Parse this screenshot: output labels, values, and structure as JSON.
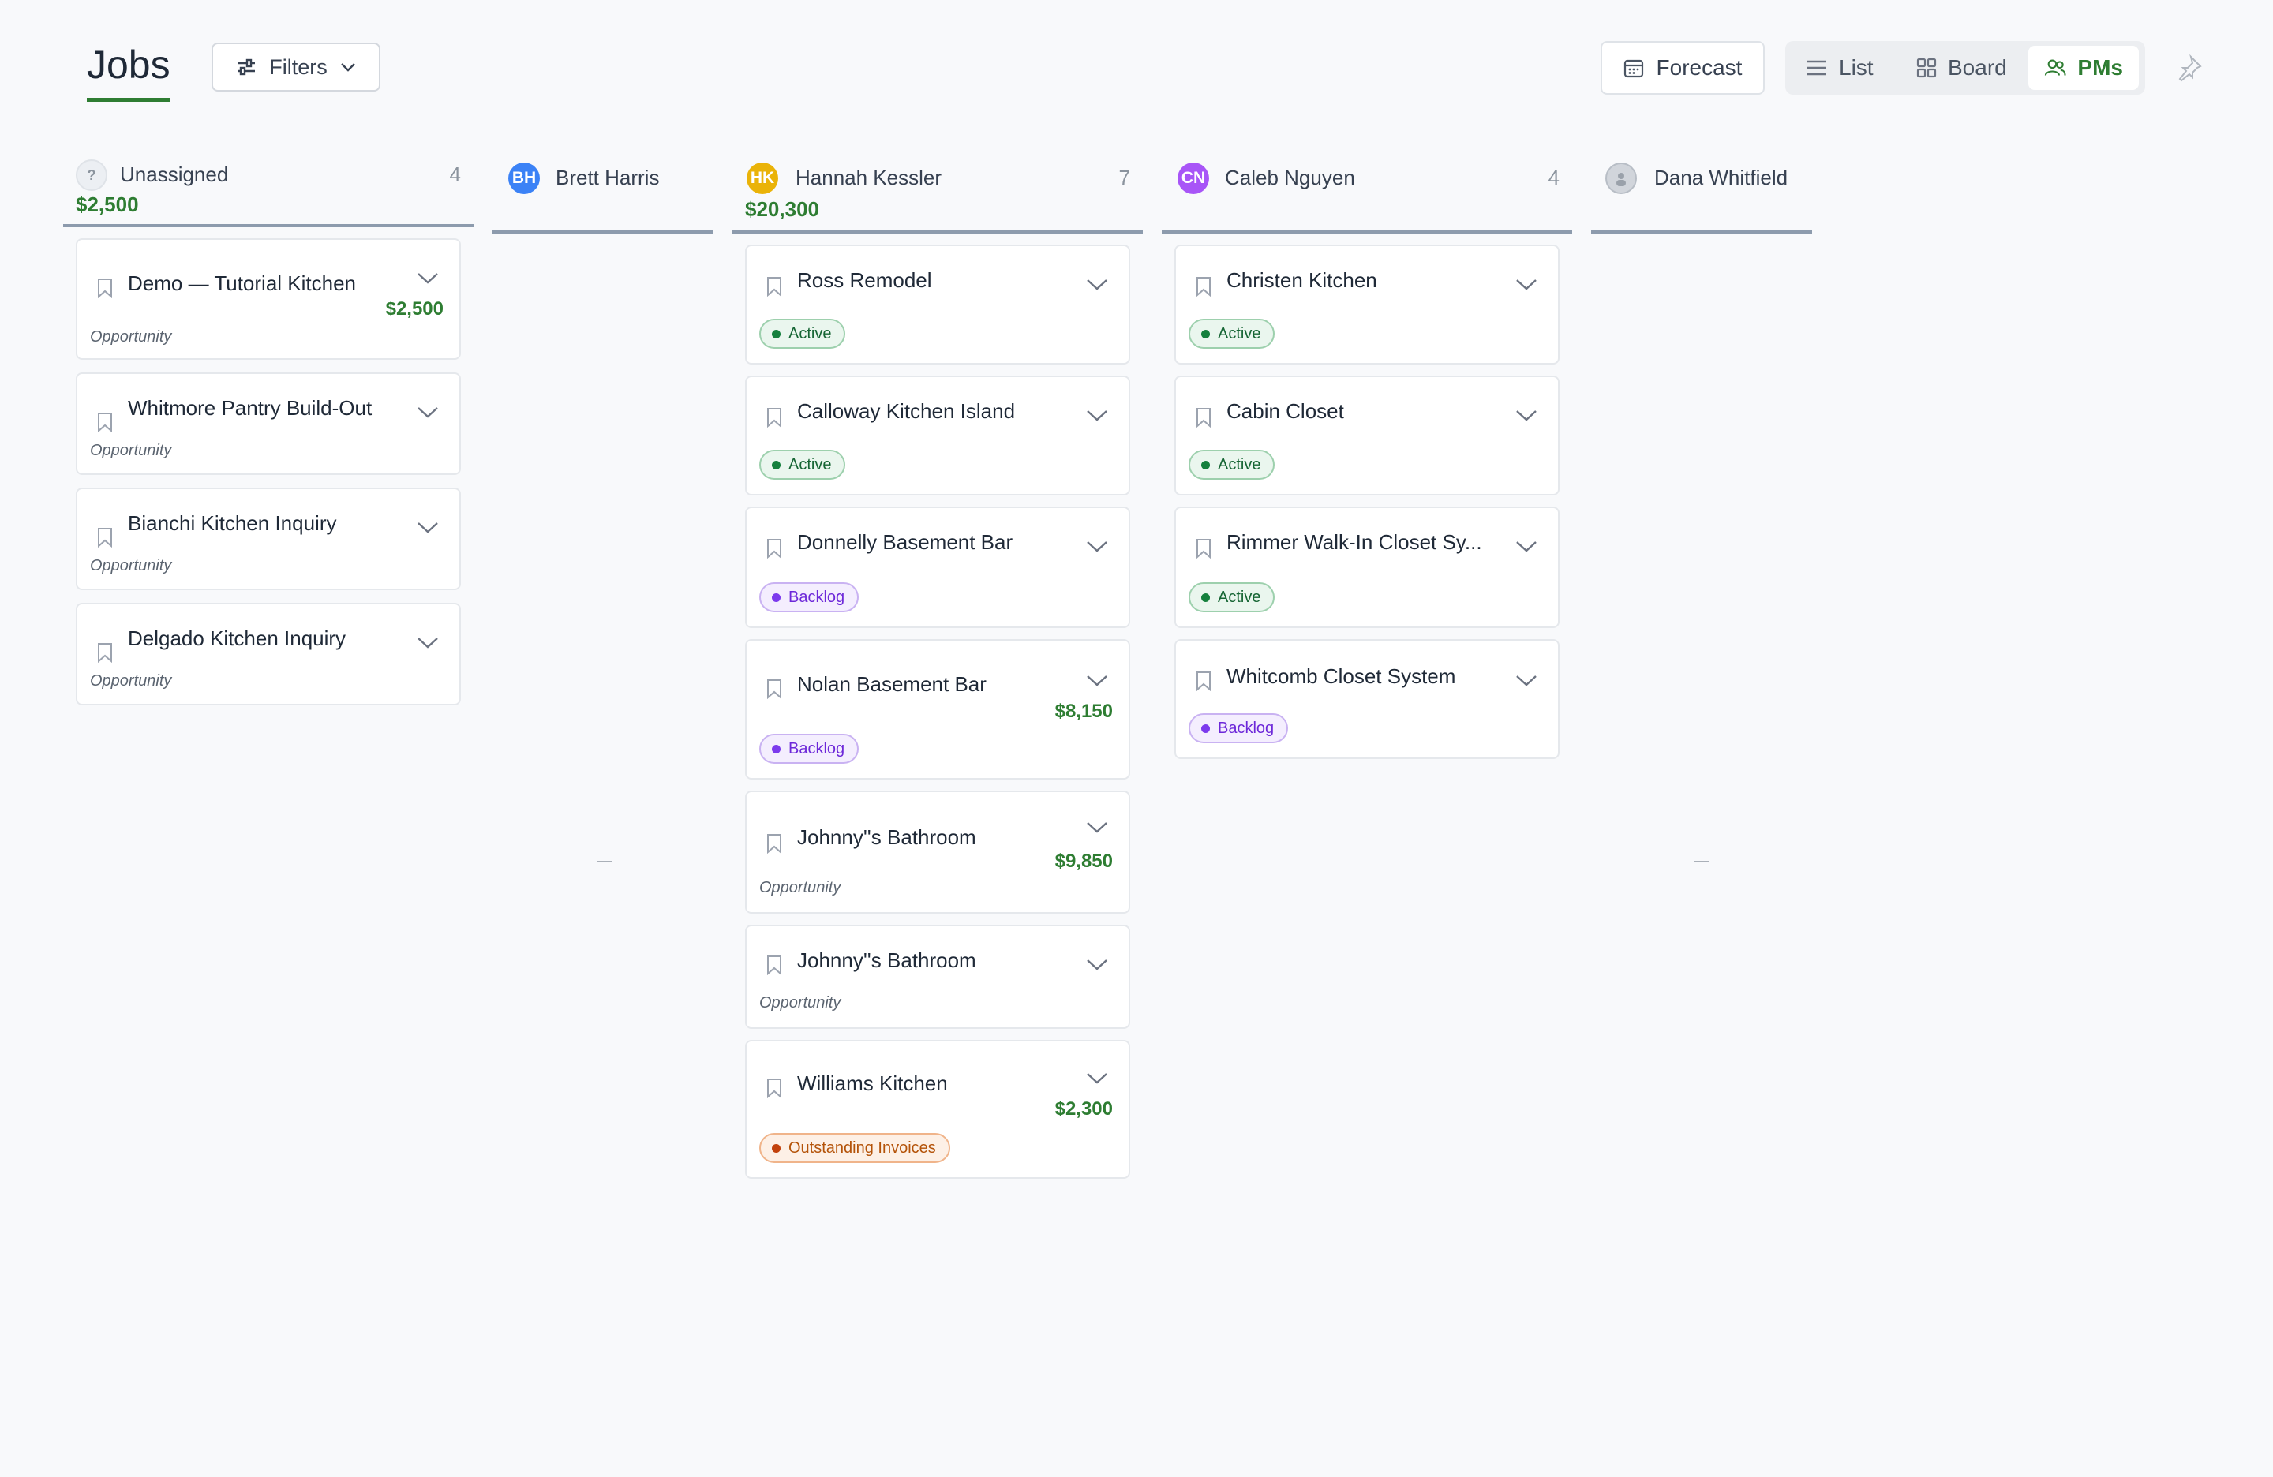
{
  "header": {
    "title": "Jobs",
    "filters_label": "Filters",
    "forecast_label": "Forecast",
    "views": [
      {
        "label": "List",
        "icon": "list-icon",
        "active": false
      },
      {
        "label": "Board",
        "icon": "board-icon",
        "active": false
      },
      {
        "label": "PMs",
        "icon": "users-icon",
        "active": true
      }
    ],
    "pin_icon": "pin-icon"
  },
  "columns": [
    {
      "name": "Unassigned",
      "initials": "?",
      "count": "4",
      "total": "$2,500",
      "avatar_color": "#eceff3"
    },
    {
      "name": "Brett Harris",
      "initials": "BH",
      "count": "",
      "total": "",
      "avatar_color": "#3b82f6",
      "empty_marker": "—"
    },
    {
      "name": "Hannah Kessler",
      "initials": "HK",
      "count": "7",
      "total": "$20,300",
      "avatar_color": "#eab308"
    },
    {
      "name": "Caleb Nguyen",
      "initials": "CN",
      "count": "4",
      "total": "",
      "avatar_color": "#a855f7"
    },
    {
      "name": "Dana Whitfield",
      "initials": "",
      "count": "",
      "total": "",
      "avatar_color": "#d1d5db",
      "empty_marker": "—"
    }
  ],
  "cards": {
    "unassigned": [
      {
        "title": "Demo — Tutorial Kitchen",
        "amount": "$2,500",
        "stage": "Opportunity"
      },
      {
        "title": "Whitmore Pantry Build-Out",
        "stage": "Opportunity"
      },
      {
        "title": "Bianchi Kitchen Inquiry",
        "stage": "Opportunity"
      },
      {
        "title": "Delgado Kitchen Inquiry",
        "stage": "Opportunity"
      }
    ],
    "hannah": [
      {
        "title": "Ross Remodel",
        "badge": "Active"
      },
      {
        "title": "Calloway Kitchen Island",
        "badge": "Active"
      },
      {
        "title": "Donnelly Basement Bar",
        "badge": "Backlog"
      },
      {
        "title": "Nolan Basement Bar",
        "amount": "$8,150",
        "badge": "Backlog"
      },
      {
        "title": "Johnny''s Bathroom",
        "amount": "$9,850",
        "stage": "Opportunity"
      },
      {
        "title": "Johnny''s Bathroom",
        "stage": "Opportunity"
      },
      {
        "title": "Williams Kitchen",
        "amount": "$2,300",
        "badge": "Outstanding Invoices"
      }
    ],
    "caleb": [
      {
        "title": "Christen Kitchen",
        "badge": "Active"
      },
      {
        "title": "Cabin Closet",
        "badge": "Active"
      },
      {
        "title": "Rimmer Walk-In Closet Sy...",
        "badge": "Active"
      },
      {
        "title": "Whitcomb Closet System",
        "badge": "Backlog"
      }
    ]
  },
  "colors": {
    "accent": "#2e7d32",
    "active": "#15803d",
    "backlog": "#7c3aed",
    "outstanding": "#c2410c"
  }
}
